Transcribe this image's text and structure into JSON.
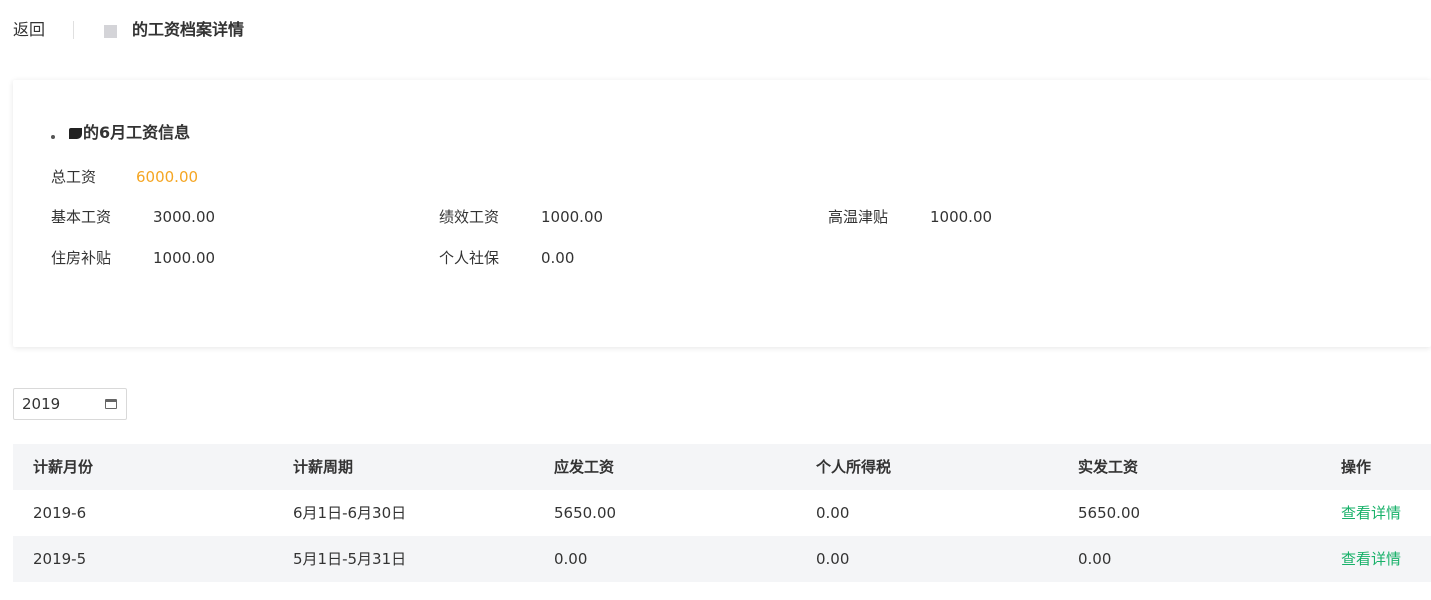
{
  "header": {
    "back_label": "返回",
    "title": "的工资档案详情"
  },
  "card": {
    "title": "的6月工资信息",
    "total": {
      "label": "总工资",
      "value": "6000.00"
    },
    "items": [
      {
        "label": "基本工资",
        "value": "3000.00"
      },
      {
        "label": "绩效工资",
        "value": "1000.00"
      },
      {
        "label": "高温津贴",
        "value": "1000.00"
      },
      {
        "label": "住房补贴",
        "value": "1000.00"
      },
      {
        "label": "个人社保",
        "value": "0.00"
      }
    ]
  },
  "year_picker": {
    "value": "2019",
    "icon": "calendar-icon"
  },
  "table": {
    "columns": [
      "计薪月份",
      "计薪周期",
      "应发工资",
      "个人所得税",
      "实发工资",
      "操作"
    ],
    "rows": [
      {
        "month": "2019-6",
        "period": "6月1日-6月30日",
        "gross": "5650.00",
        "tax": "0.00",
        "net": "5650.00",
        "action": "查看详情"
      },
      {
        "month": "2019-5",
        "period": "5月1日-5月31日",
        "gross": "0.00",
        "tax": "0.00",
        "net": "0.00",
        "action": "查看详情"
      }
    ]
  },
  "colors": {
    "accent_orange": "#f5a623",
    "link_green": "#17b169",
    "header_bg": "#f4f5f7"
  }
}
